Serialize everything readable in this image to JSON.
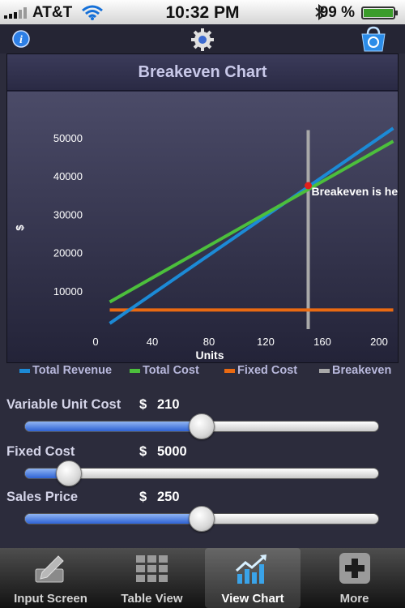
{
  "status_bar": {
    "carrier": "AT&T",
    "time": "10:32 PM",
    "battery": "99 %"
  },
  "chart_title": "Breakeven Chart",
  "chart_data": {
    "type": "line",
    "xlabel": "Units",
    "ylabel": "$",
    "xlim": [
      0,
      200
    ],
    "ylim": [
      0,
      52000
    ],
    "xticks": [
      0,
      40,
      80,
      120,
      160,
      200
    ],
    "yticks": [
      10000,
      20000,
      30000,
      40000,
      50000
    ],
    "series": [
      {
        "name": "Total Revenue",
        "color": "#1c8ad6",
        "x": [
          10,
          210
        ],
        "y": [
          1500,
          52500
        ]
      },
      {
        "name": "Total Cost",
        "color": "#4cbf3c",
        "x": [
          10,
          210
        ],
        "y": [
          7100,
          49100
        ]
      },
      {
        "name": "Fixed Cost",
        "color": "#ea6a12",
        "x": [
          10,
          210
        ],
        "y": [
          5000,
          5000
        ]
      },
      {
        "name": "Breakeven",
        "color": "#a9a9a9",
        "x": [
          150,
          150
        ],
        "y": [
          0,
          52000
        ]
      }
    ],
    "breakeven_point": {
      "x": 150,
      "y": 37500
    },
    "annotation": "Breakeven is he"
  },
  "legend": [
    "Total Revenue",
    "Total Cost",
    "Fixed Cost",
    "Breakeven"
  ],
  "controls": [
    {
      "label": "Variable Unit Cost",
      "currency": "$",
      "value": "210",
      "level": 0.5
    },
    {
      "label": "Fixed Cost",
      "currency": "$",
      "value": "5000",
      "level": 0.125
    },
    {
      "label": "Sales Price",
      "currency": "$",
      "value": "250",
      "level": 0.5
    }
  ],
  "tabs": [
    {
      "label": "Input Screen",
      "icon": "edit-icon",
      "active": false
    },
    {
      "label": "Table View",
      "icon": "grid-icon",
      "active": false
    },
    {
      "label": "View Chart",
      "icon": "chart-icon",
      "active": true
    },
    {
      "label": "More",
      "icon": "plus-icon",
      "active": false
    }
  ]
}
